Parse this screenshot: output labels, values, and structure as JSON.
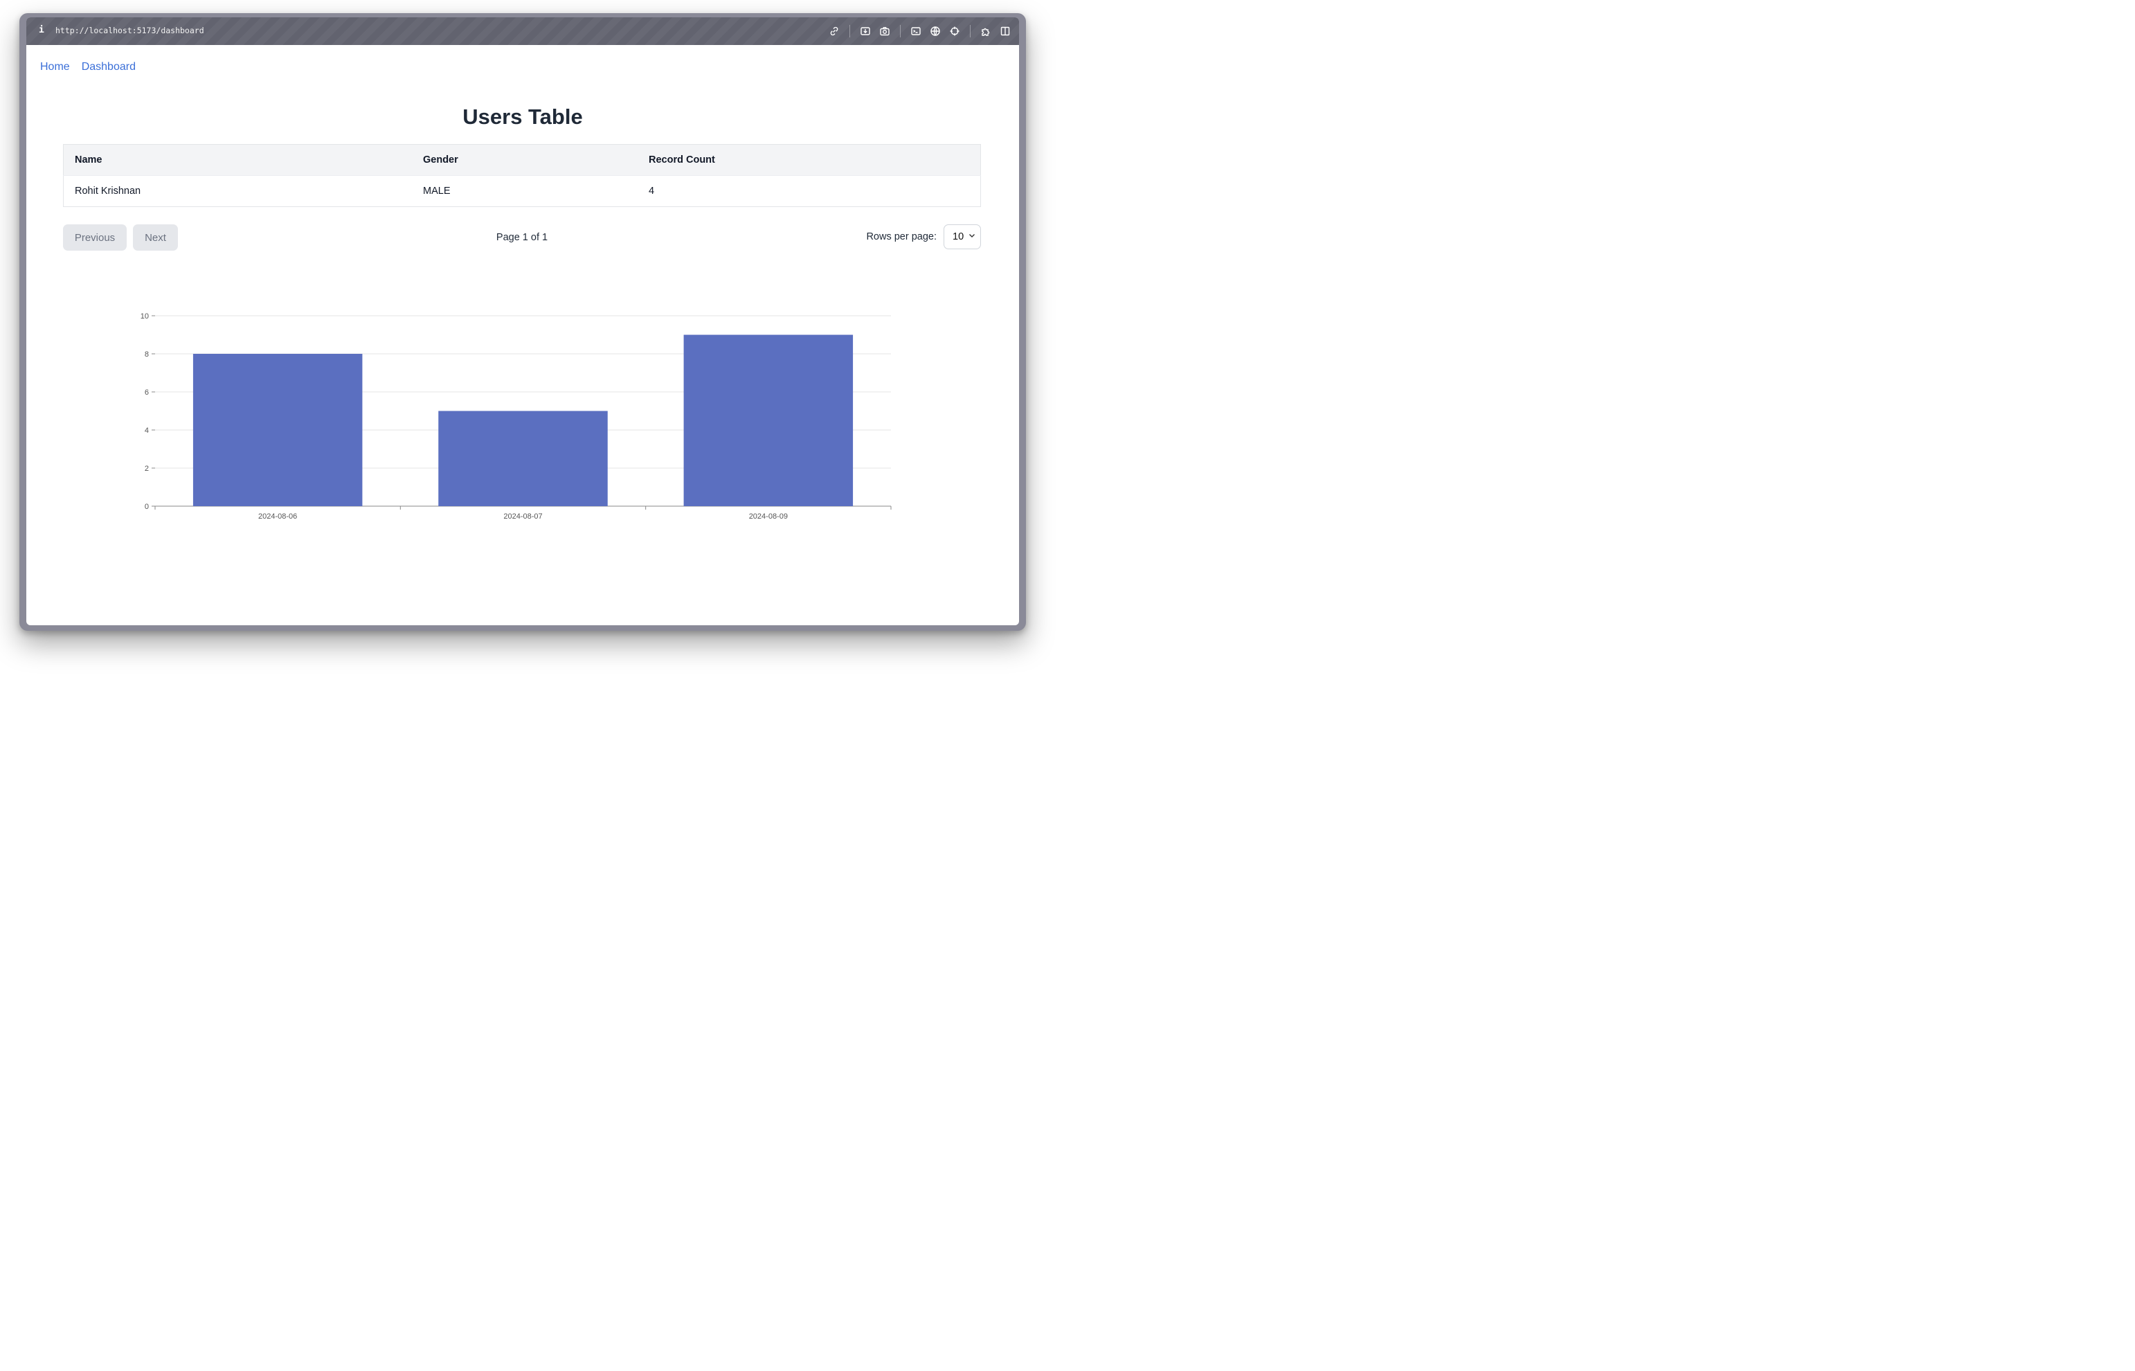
{
  "browser": {
    "info_glyph": "i",
    "url": "http://localhost:5173/dashboard",
    "icons": [
      "link-icon",
      "download-icon",
      "camera-icon",
      "terminal-icon",
      "globe-icon",
      "crosshair-icon",
      "puzzle-icon",
      "sidebar-icon"
    ]
  },
  "nav": {
    "home": "Home",
    "dashboard": "Dashboard"
  },
  "page": {
    "title": "Users Table"
  },
  "table": {
    "headers": [
      "Name",
      "Gender",
      "Record Count"
    ],
    "rows": [
      [
        "Rohit Krishnan",
        "MALE",
        "4"
      ]
    ]
  },
  "pager": {
    "previous": "Previous",
    "next": "Next",
    "page_info": "Page 1 of 1",
    "rows_label": "Rows per page:",
    "rows_value": "10"
  },
  "chart_data": {
    "type": "bar",
    "categories": [
      "2024-08-06",
      "2024-08-07",
      "2024-08-09"
    ],
    "values": [
      8,
      5,
      9
    ],
    "ylim": [
      0,
      10
    ],
    "yticks": [
      0,
      2,
      4,
      6,
      8,
      10
    ],
    "grid": true,
    "color": "#5b6fc0"
  }
}
